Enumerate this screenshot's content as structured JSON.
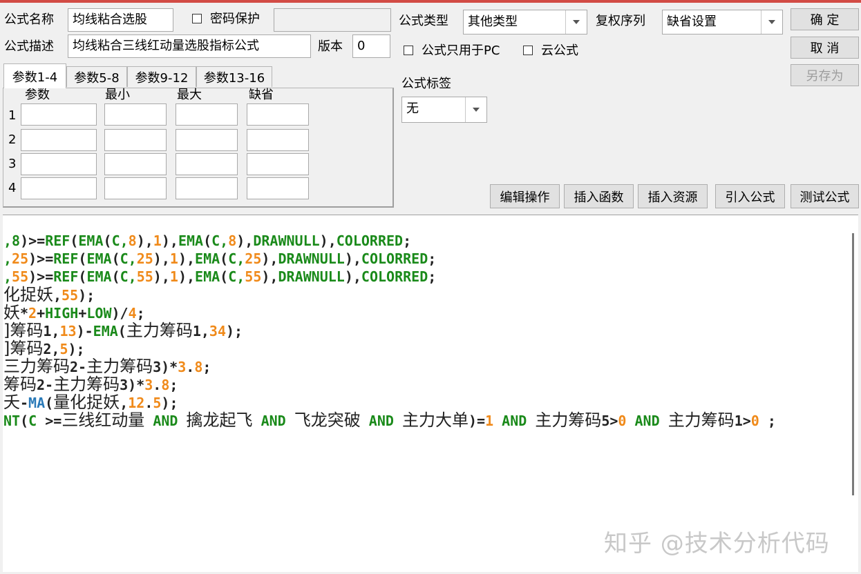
{
  "header": {
    "formula_name_label": "公式名称",
    "formula_name_value": "均线粘合选股",
    "password_label": "密码保护",
    "password_value": "",
    "formula_desc_label": "公式描述",
    "formula_desc_value": "均线粘合三线红动量选股指标公式",
    "version_label": "版本",
    "version_value": "0",
    "formula_type_label": "公式类型",
    "formula_type_value": "其他类型",
    "rights_label": "复权序列",
    "rights_value": "缺省设置",
    "pc_only_label": "公式只用于PC",
    "cloud_label": "云公式",
    "tag_label": "公式标签",
    "tag_value": "无"
  },
  "buttons": {
    "ok": "确  定",
    "cancel": "取  消",
    "save_as": "另存为",
    "edit_ops": "编辑操作",
    "insert_func": "插入函数",
    "insert_res": "插入资源",
    "import_formula": "引入公式",
    "test_formula": "测试公式"
  },
  "params": {
    "tabs": [
      "参数1-4",
      "参数5-8",
      "参数9-12",
      "参数13-16"
    ],
    "columns": [
      "参数",
      "最小",
      "最大",
      "缺省"
    ],
    "rows": [
      "1",
      "2",
      "3",
      "4"
    ]
  },
  "code": {
    "lines": [
      [
        [
          "g",
          ",8"
        ],
        [
          "b",
          ")>="
        ],
        [
          "g",
          "REF"
        ],
        [
          "b",
          "("
        ],
        [
          "g",
          "EMA"
        ],
        [
          "b",
          "("
        ],
        [
          "g",
          "C,"
        ],
        [
          "o",
          "8"
        ],
        [
          "b",
          "),"
        ],
        [
          "o",
          "1"
        ],
        [
          "b",
          "),"
        ],
        [
          "g",
          "EMA"
        ],
        [
          "b",
          "("
        ],
        [
          "g",
          "C,"
        ],
        [
          "o",
          "8"
        ],
        [
          "b",
          "),"
        ],
        [
          "g",
          "DRAWNULL"
        ],
        [
          "b",
          "),"
        ],
        [
          "g",
          "COLORRED"
        ],
        [
          "b",
          ";"
        ]
      ],
      [
        [
          "g",
          ","
        ],
        [
          "o",
          "25"
        ],
        [
          "b",
          ")>="
        ],
        [
          "g",
          "REF"
        ],
        [
          "b",
          "("
        ],
        [
          "g",
          "EMA"
        ],
        [
          "b",
          "("
        ],
        [
          "g",
          "C,"
        ],
        [
          "o",
          "25"
        ],
        [
          "b",
          "),"
        ],
        [
          "o",
          "1"
        ],
        [
          "b",
          "),"
        ],
        [
          "g",
          "EMA"
        ],
        [
          "b",
          "("
        ],
        [
          "g",
          "C,"
        ],
        [
          "o",
          "25"
        ],
        [
          "b",
          "),"
        ],
        [
          "g",
          "DRAWNULL"
        ],
        [
          "b",
          "),"
        ],
        [
          "g",
          "COLORRED"
        ],
        [
          "b",
          ";"
        ]
      ],
      [
        [
          "g",
          ","
        ],
        [
          "o",
          "55"
        ],
        [
          "b",
          ")>="
        ],
        [
          "g",
          "REF"
        ],
        [
          "b",
          "("
        ],
        [
          "g",
          "EMA"
        ],
        [
          "b",
          "("
        ],
        [
          "g",
          "C,"
        ],
        [
          "o",
          "55"
        ],
        [
          "b",
          "),"
        ],
        [
          "o",
          "1"
        ],
        [
          "b",
          "),"
        ],
        [
          "g",
          "EMA"
        ],
        [
          "b",
          "("
        ],
        [
          "g",
          "C,"
        ],
        [
          "o",
          "55"
        ],
        [
          "b",
          "),"
        ],
        [
          "g",
          "DRAWNULL"
        ],
        [
          "b",
          "),"
        ],
        [
          "g",
          "COLORRED"
        ],
        [
          "b",
          ";"
        ]
      ],
      [
        [
          "zh",
          "化捉妖"
        ],
        [
          "b",
          ","
        ],
        [
          "o",
          "55"
        ],
        [
          "b",
          ");"
        ]
      ],
      [
        [
          "zh",
          "妖"
        ],
        [
          "b",
          "*"
        ],
        [
          "o",
          "2"
        ],
        [
          "b",
          "+"
        ],
        [
          "g",
          "HIGH"
        ],
        [
          "b",
          "+"
        ],
        [
          "g",
          "LOW"
        ],
        [
          "b",
          ")/"
        ],
        [
          "o",
          "4"
        ],
        [
          "b",
          ";"
        ]
      ],
      [
        [
          "zh",
          "]筹码"
        ],
        [
          "b",
          "1,"
        ],
        [
          "o",
          "13"
        ],
        [
          "b",
          ")-"
        ],
        [
          "g",
          "EMA"
        ],
        [
          "b",
          "("
        ],
        [
          "zh",
          "主力筹码"
        ],
        [
          "b",
          "1,"
        ],
        [
          "o",
          "34"
        ],
        [
          "b",
          ");"
        ]
      ],
      [
        [
          "zh",
          "]筹码"
        ],
        [
          "b",
          "2,"
        ],
        [
          "o",
          "5"
        ],
        [
          "b",
          ");"
        ]
      ],
      [
        [
          "zh",
          "三力筹码"
        ],
        [
          "b",
          "2-"
        ],
        [
          "zh",
          "主力筹码"
        ],
        [
          "b",
          "3)*"
        ],
        [
          "o",
          "3"
        ],
        [
          "b",
          "."
        ],
        [
          "o",
          "8"
        ],
        [
          "b",
          ";"
        ]
      ],
      [
        [
          "zh",
          "筹码"
        ],
        [
          "b",
          "2-"
        ],
        [
          "zh",
          "主力筹码"
        ],
        [
          "b",
          "3)*"
        ],
        [
          "o",
          "3"
        ],
        [
          "b",
          "."
        ],
        [
          "o",
          "8"
        ],
        [
          "b",
          ";"
        ]
      ],
      [
        [
          "zh",
          "夭"
        ],
        [
          "b",
          "-"
        ],
        [
          "cb",
          "MA"
        ],
        [
          "b",
          "("
        ],
        [
          "zh",
          "量化捉妖"
        ],
        [
          "b",
          ","
        ],
        [
          "o",
          "12"
        ],
        [
          "b",
          "."
        ],
        [
          "o",
          "5"
        ],
        [
          "b",
          ");"
        ]
      ],
      [
        [
          "g",
          "NT"
        ],
        [
          "b",
          "("
        ],
        [
          "g",
          "C"
        ],
        [
          "b",
          " >="
        ],
        [
          "zh",
          "三线红动量"
        ],
        [
          "g",
          " AND "
        ],
        [
          "zh",
          "擒龙起飞"
        ],
        [
          "g",
          " AND "
        ],
        [
          "zh",
          "飞龙突破"
        ],
        [
          "g",
          " AND "
        ],
        [
          "zh",
          "主力大单"
        ],
        [
          "b",
          ")="
        ],
        [
          "o",
          "1"
        ],
        [
          "g",
          " AND "
        ],
        [
          "zh",
          "主力筹码"
        ],
        [
          "b",
          "5>"
        ],
        [
          "o",
          "0"
        ],
        [
          "g",
          " AND "
        ],
        [
          "zh",
          "主力筹码"
        ],
        [
          "b",
          "1>"
        ],
        [
          "o",
          "0"
        ],
        [
          "b",
          " ;"
        ]
      ]
    ]
  },
  "watermark": "知乎 @技术分析代码"
}
